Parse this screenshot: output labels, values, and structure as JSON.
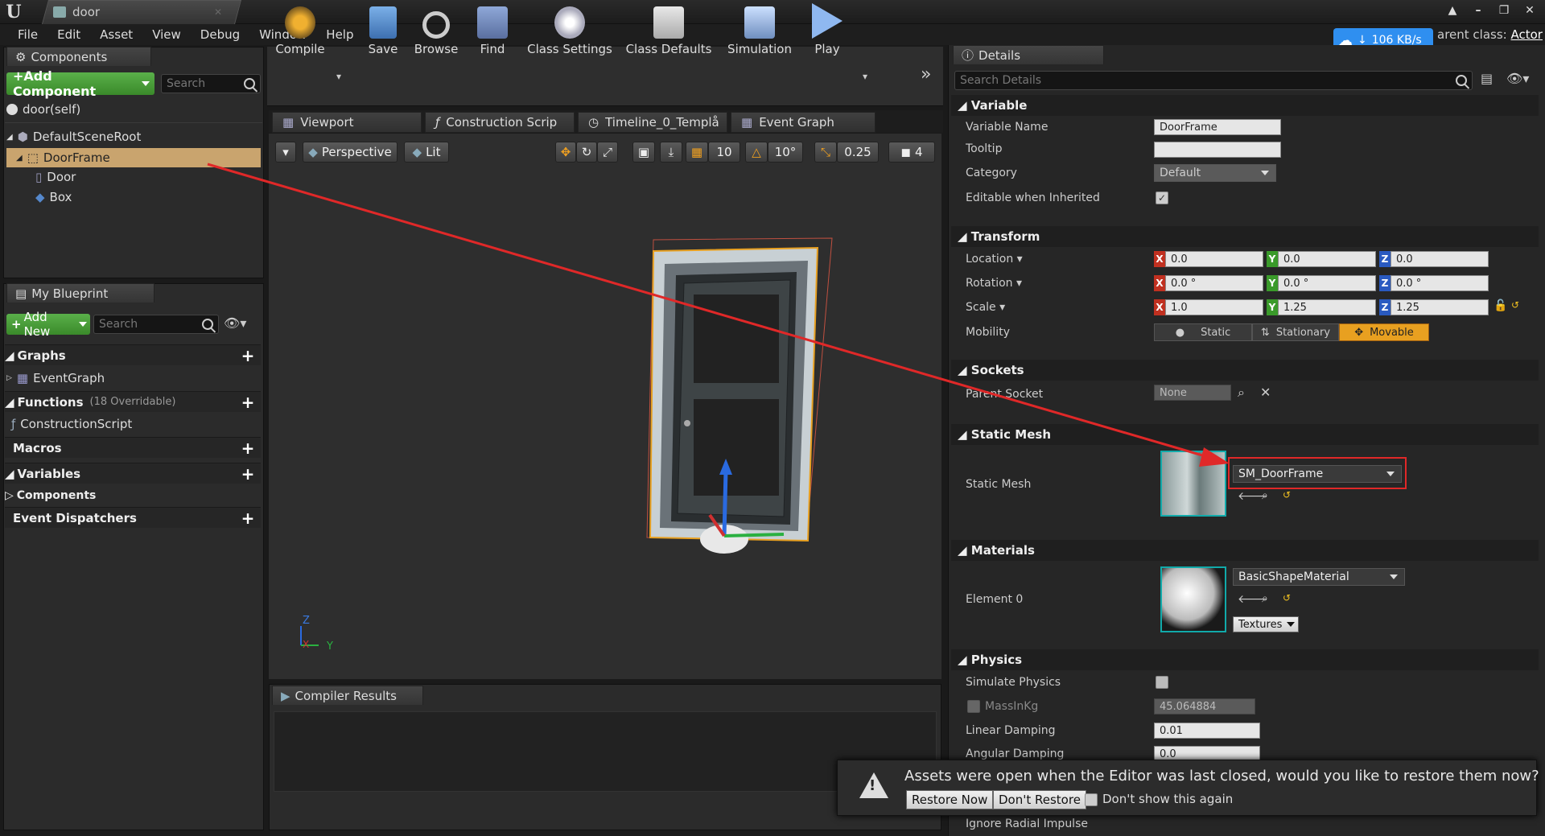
{
  "window": {
    "tab_title": "door",
    "parent_class_label": "arent class:",
    "parent_class_value": "Actor"
  },
  "menu": [
    "File",
    "Edit",
    "Asset",
    "View",
    "Debug",
    "Window",
    "Help"
  ],
  "network_badge": "106 KB/s",
  "components": {
    "tab_label": "Components",
    "add_label": "+Add Component",
    "search_placeholder": "Search",
    "self_item": "door(self)",
    "tree": [
      "DefaultSceneRoot",
      "DoorFrame",
      "Door",
      "Box"
    ]
  },
  "blueprint": {
    "tab_label": "My Blueprint",
    "add_new_label": "Add New",
    "search_placeholder": "Search",
    "graphs_label": "Graphs",
    "event_graph_item": "EventGraph",
    "functions_label": "Functions",
    "functions_count": "(18 Overridable)",
    "construction_item": "ConstructionScript",
    "macros_label": "Macros",
    "variables_label": "Variables",
    "components_label": "Components",
    "dispatchers_label": "Event Dispatchers"
  },
  "toolbar": [
    "Compile",
    "Save",
    "Browse",
    "Find",
    "Class Settings",
    "Class Defaults",
    "Simulation",
    "Play"
  ],
  "editor_tabs": [
    "Viewport",
    "Construction Scrip",
    "Timeline_0_Templå",
    "Event Graph"
  ],
  "viewport": {
    "perspective": "Perspective",
    "lit": "Lit",
    "grid_snap": "10",
    "rot_snap": "10°",
    "scale_snap": "0.25",
    "cam_speed": "4",
    "axis_z": "Z",
    "axis_x": "X",
    "axis_y": "Y"
  },
  "compiler_tab": "Compiler Results",
  "details": {
    "tab_label": "Details",
    "search_placeholder": "Search Details",
    "variable_section": "Variable",
    "var_name_label": "Variable Name",
    "var_name_value": "DoorFrame",
    "tooltip_label": "Tooltip",
    "category_label": "Category",
    "category_value": "Default",
    "editable_label": "Editable when Inherited",
    "transform_section": "Transform",
    "location_label": "Location",
    "location": [
      "0.0",
      "0.0",
      "0.0"
    ],
    "rotation_label": "Rotation",
    "rotation": [
      "0.0 °",
      "0.0 °",
      "0.0 °"
    ],
    "scale_label": "Scale",
    "scale": [
      "1.0",
      "1.25",
      "1.25"
    ],
    "mobility_label": "Mobility",
    "mobility_options": [
      "Static",
      "Stationary",
      "Movable"
    ],
    "sockets_section": "Sockets",
    "parent_socket_label": "Parent Socket",
    "parent_socket_value": "None",
    "static_mesh_section": "Static Mesh",
    "static_mesh_label": "Static Mesh",
    "static_mesh_value": "SM_DoorFrame",
    "materials_section": "Materials",
    "element0_label": "Element 0",
    "material_value": "BasicShapeMaterial",
    "textures_label": "Textures",
    "physics_section": "Physics",
    "simulate_label": "Simulate Physics",
    "mass_label": "MassInKg",
    "mass_value": "45.064884",
    "linear_label": "Linear Damping",
    "linear_value": "0.01",
    "angular_label": "Angular Damping",
    "angular_value": "0.0",
    "radial_label": "Ignore Radial Impulse"
  },
  "notification": {
    "message": "Assets were open when the Editor was last closed, would you like to restore them now?",
    "restore": "Restore Now",
    "dont_restore": "Don't Restore",
    "dont_show": "Don't show this again"
  },
  "colors": {
    "accent_orange": "#f0a020",
    "add_green": "#4aa23a",
    "highlight": "#e0503a",
    "selection": "#c9a46e"
  }
}
